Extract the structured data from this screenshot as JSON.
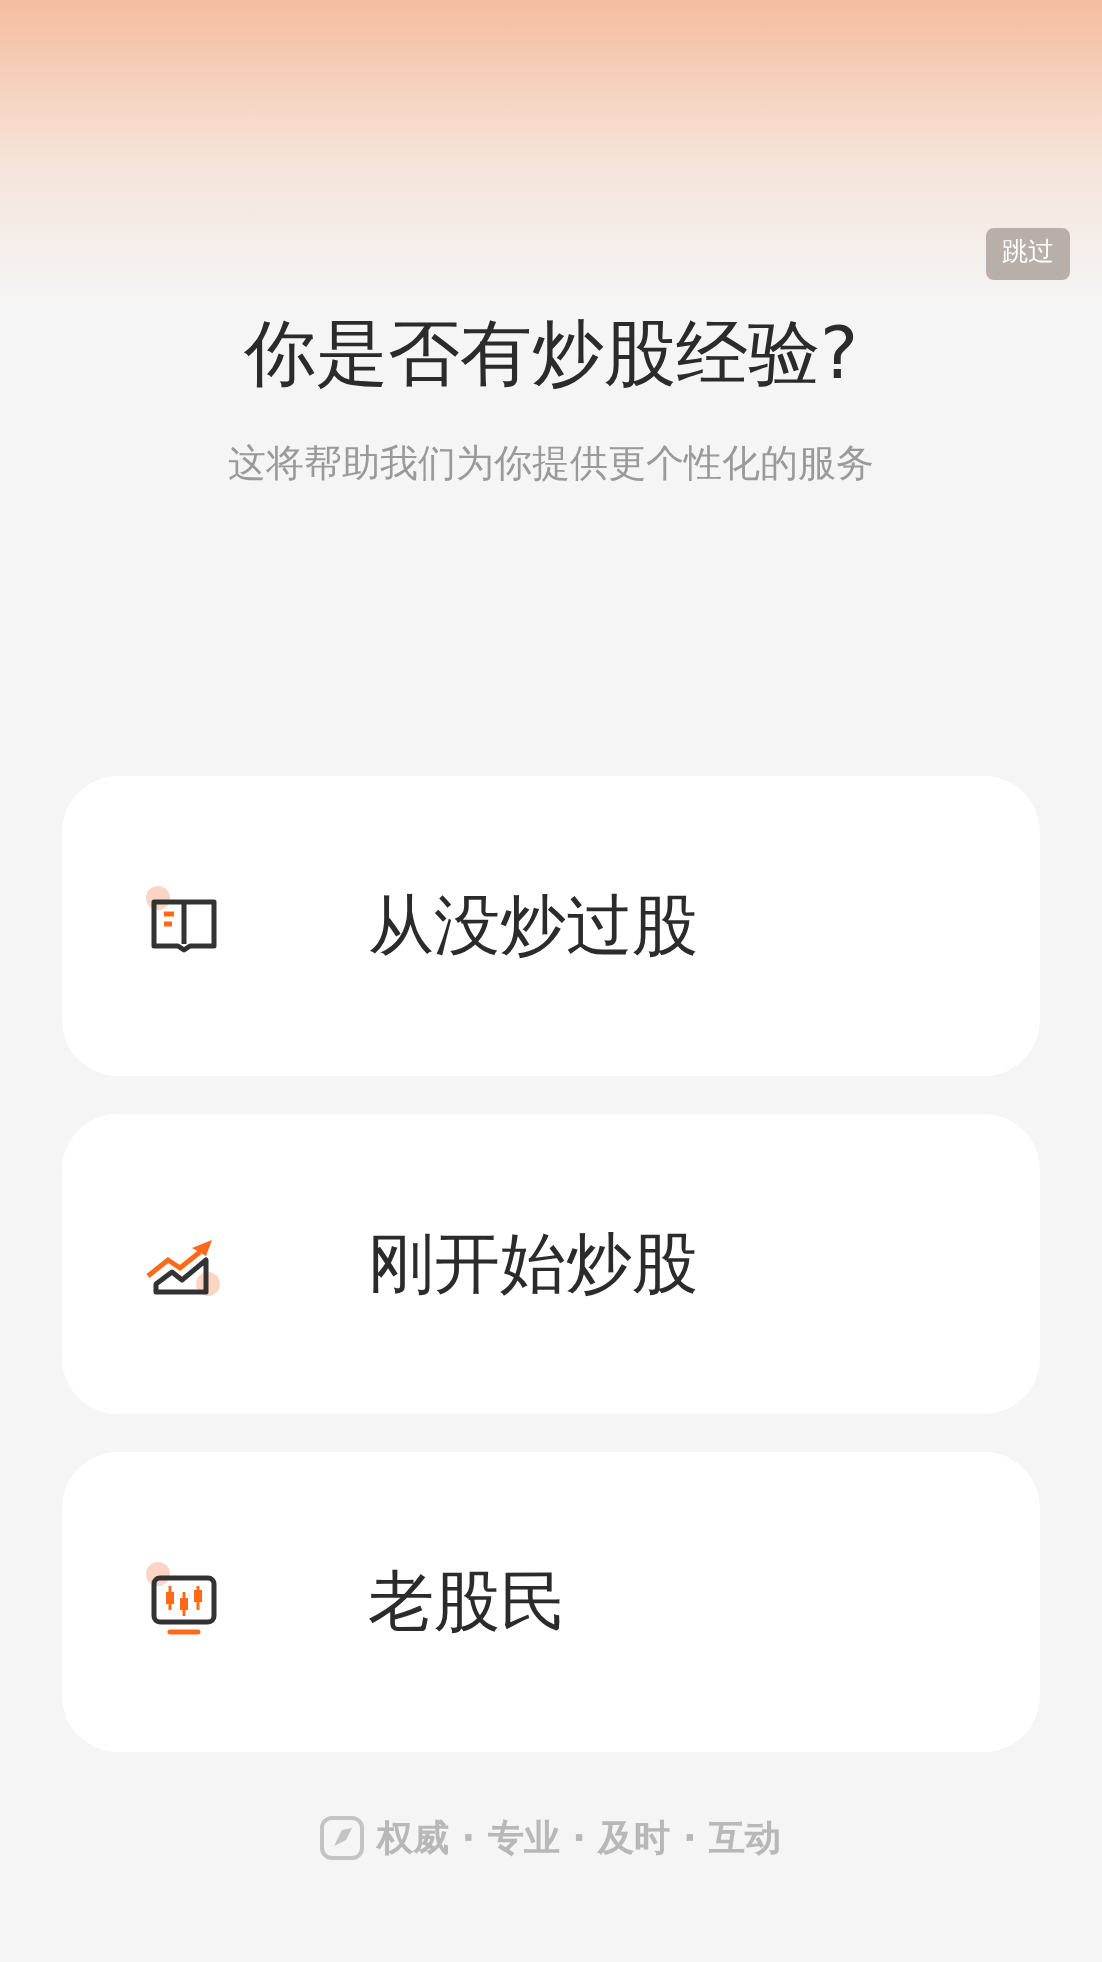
{
  "skip_button": "跳过",
  "title": "你是否有炒股经验?",
  "subtitle": "这将帮助我们为你提供更个性化的服务",
  "options": [
    {
      "kind": "book",
      "label": "从没炒过股"
    },
    {
      "kind": "trend",
      "label": "刚开始炒股"
    },
    {
      "kind": "monitor",
      "label": "老股民"
    }
  ],
  "slogan": "权威 · 专业 · 及时 · 互动"
}
